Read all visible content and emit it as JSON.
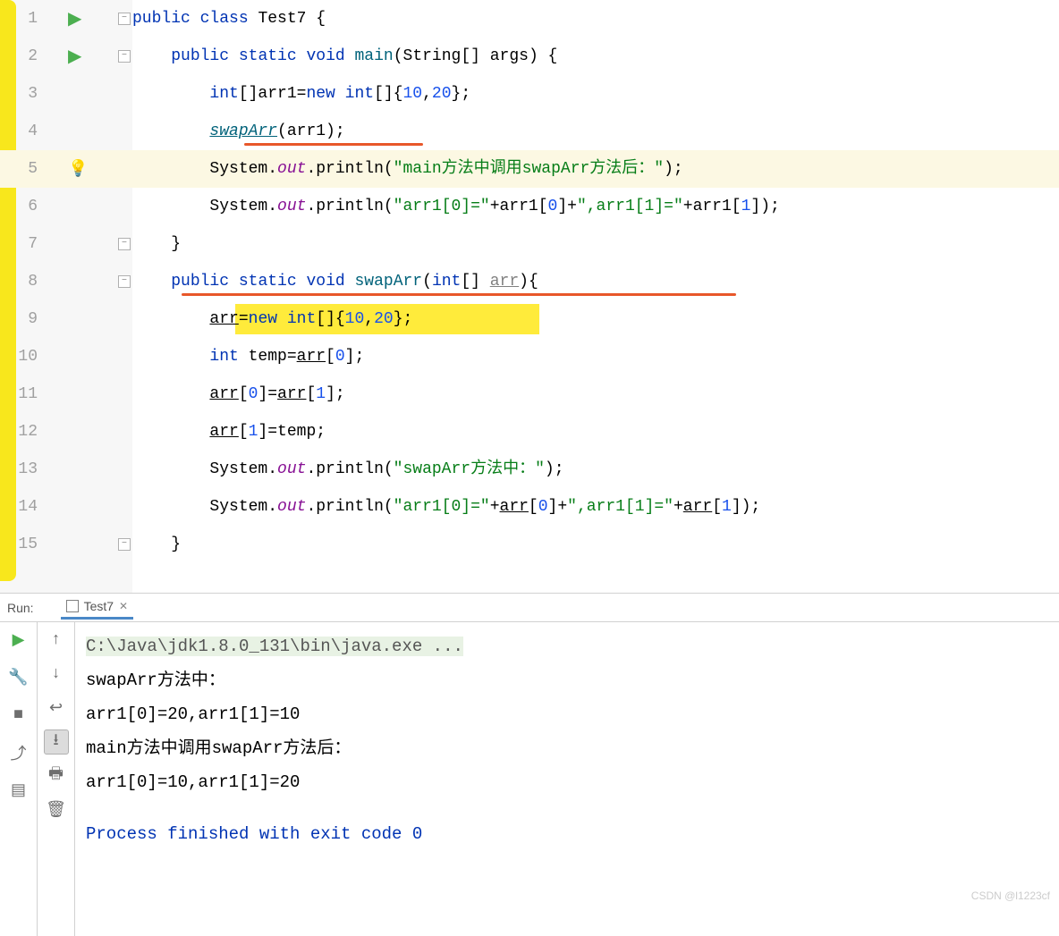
{
  "lines": [
    "1",
    "2",
    "3",
    "4",
    "5",
    "6",
    "7",
    "8",
    "9",
    "10",
    "11",
    "12",
    "13",
    "14",
    "15"
  ],
  "code": {
    "l1": {
      "kw1": "public",
      "kw2": "class",
      "name": "Test7",
      "brace": " {"
    },
    "l2": {
      "kw1": "public",
      "kw2": "static",
      "kw3": "void",
      "method": "main",
      "params": "(String[] args) {"
    },
    "l3": {
      "type": "int",
      "text": "[]arr1=",
      "kw": "new",
      "type2": "int",
      "text2": "[]{",
      "n1": "10",
      "c": ",",
      "n2": "20",
      "end": "};"
    },
    "l4": {
      "method": "swapArr",
      "text": "(arr1);"
    },
    "l5": {
      "obj": "System.",
      "field": "out",
      "dot": ".println(",
      "str": "\"main方法中调用swapArr方法后：\"",
      "end": ");"
    },
    "l6": {
      "obj": "System.",
      "field": "out",
      "dot": ".println(",
      "str1": "\"arr1[0]=\"",
      "plus1": "+arr1[",
      "n1": "0",
      "mid": "]+",
      "str2": "\",arr1[1]=\"",
      "plus2": "+arr1[",
      "n2": "1",
      "end": "]);"
    },
    "l7": {
      "brace": "}"
    },
    "l8": {
      "kw1": "public",
      "kw2": "static",
      "kw3": "void",
      "method": "swapArr",
      "open": "(",
      "type": "int",
      "br": "[] ",
      "param": "arr",
      "close": "){"
    },
    "l9": {
      "var": "arr",
      "eq": "=",
      "kw": "new",
      "type": "int",
      "text": "[]{",
      "n1": "10",
      "c": ",",
      "n2": "20",
      "end": "};"
    },
    "l10": {
      "type": "int",
      "text": " temp=",
      "var": "arr",
      "br": "[",
      "n": "0",
      "end": "];"
    },
    "l11": {
      "var1": "arr",
      "br1": "[",
      "n1": "0",
      "mid": "]=",
      "var2": "arr",
      "br2": "[",
      "n2": "1",
      "end": "];"
    },
    "l12": {
      "var": "arr",
      "br": "[",
      "n": "1",
      "end": "]=temp;"
    },
    "l13": {
      "obj": "System.",
      "field": "out",
      "dot": ".println(",
      "str": "\"swapArr方法中：\"",
      "end": ");"
    },
    "l14": {
      "obj": "System.",
      "field": "out",
      "dot": ".println(",
      "str1": "\"arr1[0]=\"",
      "plus1": "+",
      "var1": "arr",
      "br1": "[",
      "n1": "0",
      "mid": "]+",
      "str2": "\",arr1[1]=\"",
      "plus2": "+",
      "var2": "arr",
      "br2": "[",
      "n2": "1",
      "end": "]);"
    },
    "l15": {
      "brace": "}"
    }
  },
  "run": {
    "label": "Run:",
    "tab": "Test7",
    "cmd": "C:\\Java\\jdk1.8.0_131\\bin\\java.exe ...",
    "out1": "swapArr方法中：",
    "out2": "arr1[0]=20,arr1[1]=10",
    "out3": "main方法中调用swapArr方法后：",
    "out4": "arr1[0]=10,arr1[1]=20",
    "exit": "Process finished with exit code 0"
  },
  "watermark": "CSDN @l1223cf"
}
